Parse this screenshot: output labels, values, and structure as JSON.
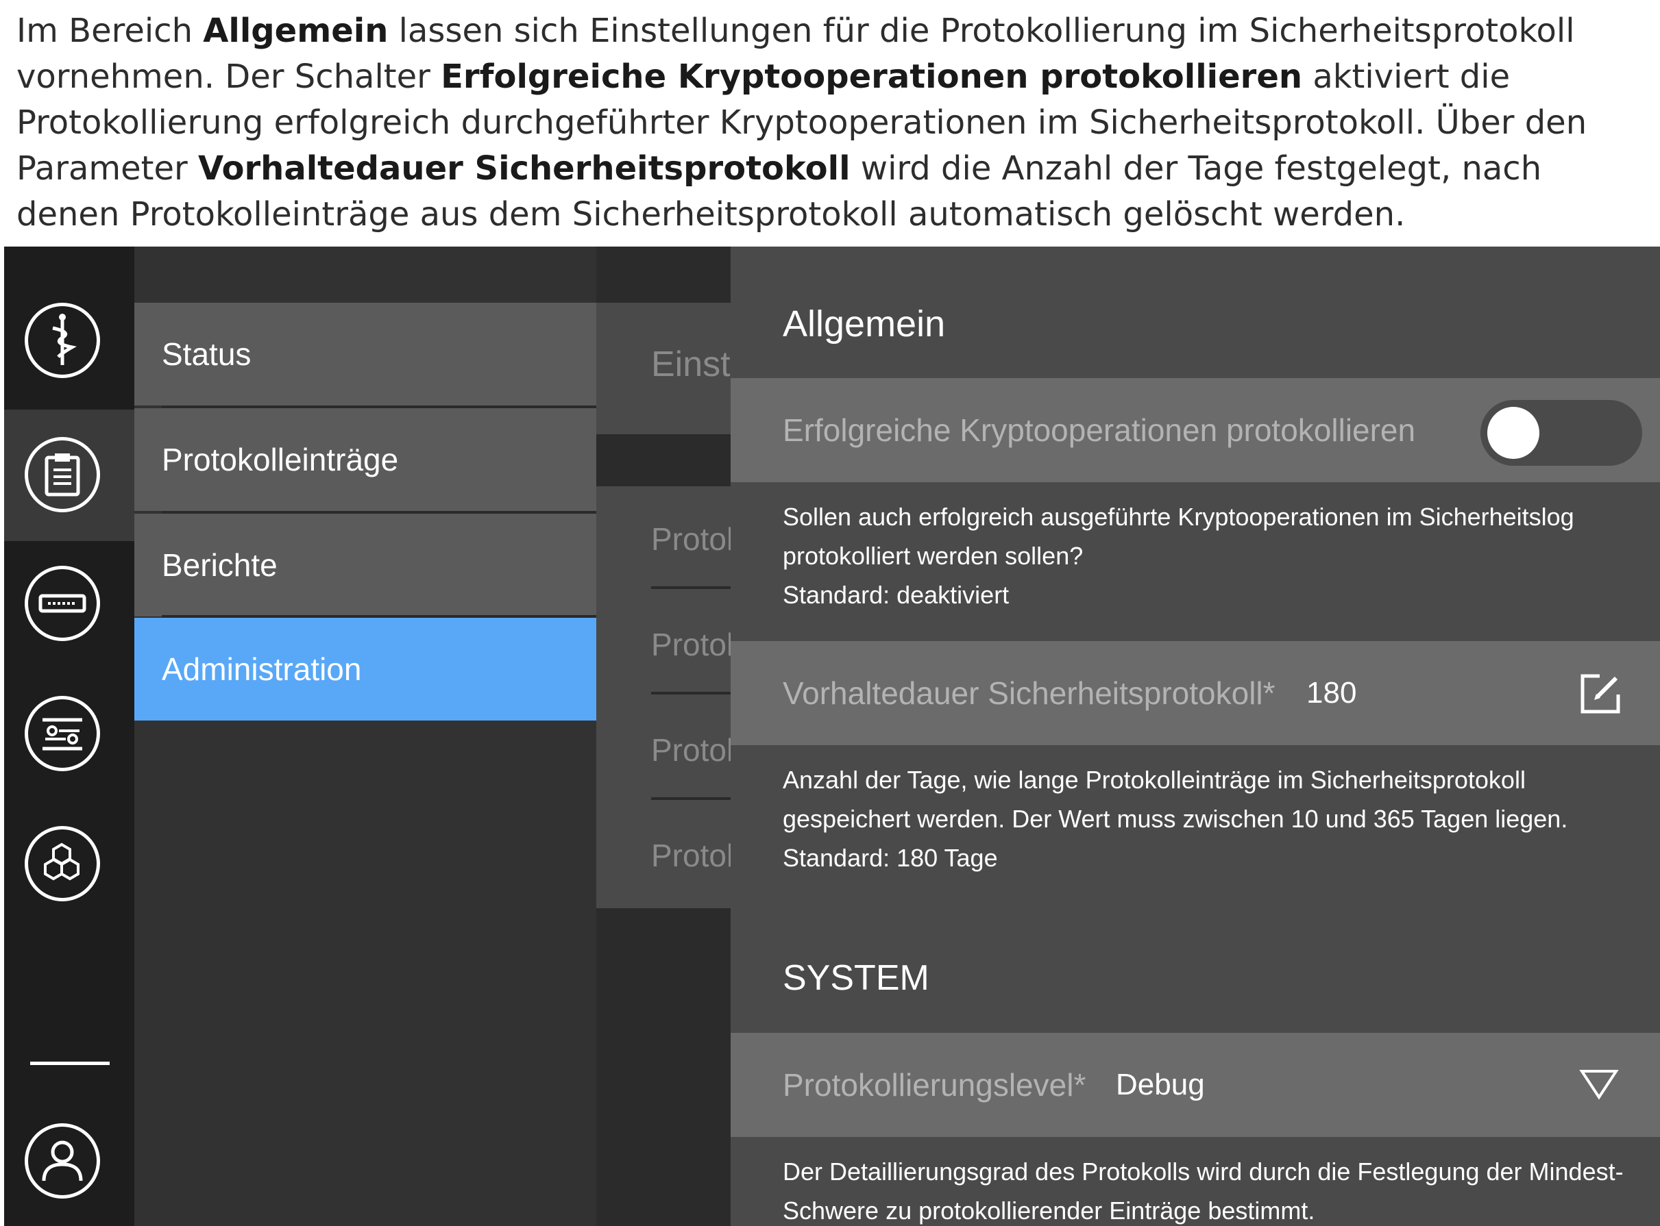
{
  "intro": {
    "t1": "Im Bereich ",
    "b1": "Allgemein",
    "t2": " lassen sich Einstellungen für die Protokollierung im Sicherheitsprotokoll vornehmen. Der Schalter ",
    "b2": "Erfolgreiche Kryptooperationen protokollieren",
    "t3": " aktiviert die Protokollierung erfolgreich durchgeführter Kryptooperationen im Sicherheitsprotokoll. Über den Parameter ",
    "b3": "Vorhaltedauer Sicherheitsprotokoll",
    "t4": " wird die Anzahl der Tage festgelegt, nach denen Protokolleinträge aus dem Sicherheitsprotokoll automatisch gelöscht werden."
  },
  "iconbar": {
    "icons": [
      "caduceus-icon",
      "clipboard-icon",
      "device-icon",
      "settings-sliders-icon",
      "hexagons-icon",
      "user-icon"
    ],
    "active_index": 1
  },
  "nav": {
    "items": [
      {
        "label": "Status",
        "active": false
      },
      {
        "label": "Protokolleinträge",
        "active": false
      },
      {
        "label": "Berichte",
        "active": false
      },
      {
        "label": "Administration",
        "active": true
      }
    ]
  },
  "middle": {
    "title": "Einst",
    "items": [
      "Protol",
      "Protol",
      "Protol",
      "Protol"
    ]
  },
  "panel": {
    "general_heading": "Allgemein",
    "crypto_setting": {
      "label": "Erfolgreiche Kryptooperationen protokollieren",
      "enabled": false,
      "desc_line1": "Sollen auch erfolgreich ausgeführte Kryptooperationen im Sicherheitslog",
      "desc_line2": "protokolliert werden sollen?",
      "desc_line3": "Standard: deaktiviert"
    },
    "retention_setting": {
      "label": "Vorhaltedauer Sicherheitsprotokoll*",
      "value": "180",
      "desc_line1": "Anzahl der Tage, wie lange Protokolleinträge im Sicherheitsprotokoll",
      "desc_line2": "gespeichert werden. Der Wert muss zwischen 10 und 365 Tagen liegen.",
      "desc_line3": "Standard: 180 Tage"
    },
    "system_heading": "SYSTEM",
    "level_setting": {
      "label": "Protokollierungslevel*",
      "value": "Debug",
      "desc_line1": "Der Detaillierungsgrad des Protokolls wird durch die Festlegung der Mindest-",
      "desc_line2": "Schwere zu protokollierender Einträge bestimmt."
    }
  },
  "colors": {
    "active_nav": "#59a8f7",
    "panel_bg": "#4a4a4a",
    "row_bg": "#6b6b6b"
  }
}
